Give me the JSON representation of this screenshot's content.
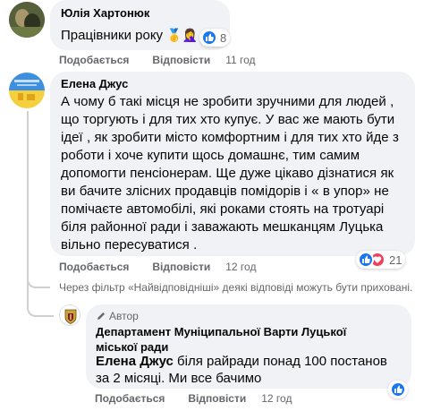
{
  "comments": [
    {
      "author": "Юлія Хартонюк",
      "text": "Працівники року",
      "emoji": "🥇🤦‍♀️",
      "reactions": {
        "count": "8"
      },
      "actions": {
        "like": "Подобається",
        "reply": "Відповісти",
        "time": "11 год"
      }
    },
    {
      "author": "Елена Джус",
      "text": "А чому б такі місця не зробити зручними для людей , що торгують і для тих хто купує. У вас же мають бути ідеї , як зробити місто комфортним і для тих хто йде з роботи і хоче купити щось домашнє, тим самим допомогти пенсіонерам. Ще дуже цікаво дізнатися як ви бачите злісних продавців помідорів і « в упор» не помічаєте автомобілі, які роками стоять на тротуарі біля районної ради і заважають мешканцям Луцька вільно пересуватися .",
      "reactions": {
        "count": "21"
      },
      "actions": {
        "like": "Подобається",
        "reply": "Відповісти",
        "time": "12 год"
      }
    }
  ],
  "filter_notice": "Через фільтр «Найвідповідніші» деякі відповіді можуть бути приховані.",
  "reply": {
    "badge": "Автор",
    "author": "Департамент Муніципальної Варти Луцької міської ради",
    "mention": "Елена Джус",
    "text": " біля райради понад 100 постанов за 2 місяці. Ми все бачимо",
    "actions": {
      "like": "Подобається",
      "reply": "Відповісти",
      "time": "12 год"
    }
  },
  "colors": {
    "bubble": "#f0f2f5",
    "like_blue": "#1877f2",
    "love_red": "#f33e58",
    "meta_gray": "#65676b"
  }
}
